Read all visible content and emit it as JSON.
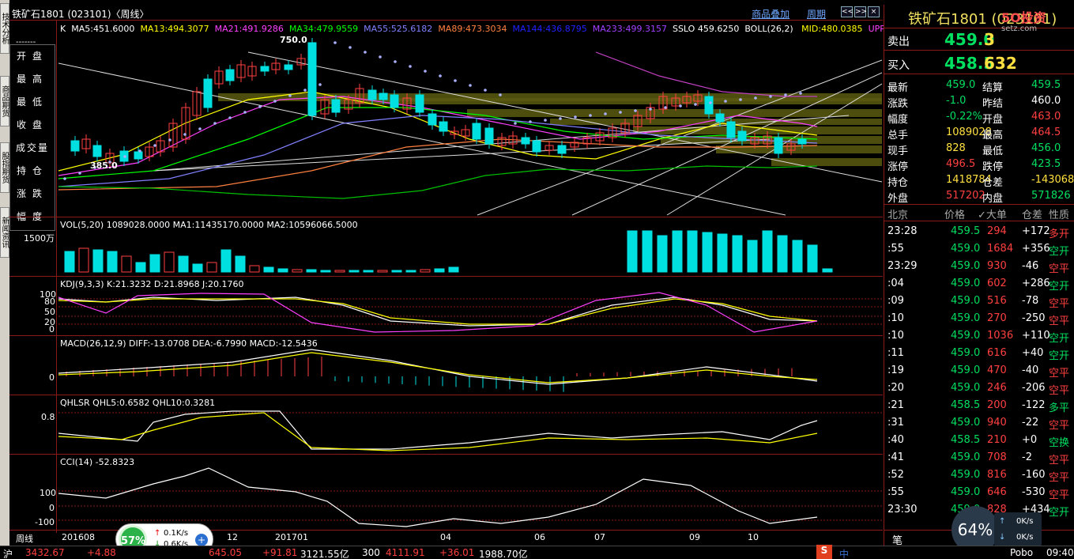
{
  "window": {
    "title": "铁矿石1801 (023101)〈周线〉",
    "links": [
      "商品叠加",
      "周期"
    ],
    "nav_buttons": [
      "<<",
      ">>",
      "×"
    ]
  },
  "side_tabs": [
    "技术分析",
    "商品期货",
    "股指期货",
    "新闻资讯"
  ],
  "left_menu": {
    "dash": "-------",
    "items": [
      "开盘",
      "最高",
      "最低",
      "收盘",
      "成交量",
      "持仓",
      "涨跌",
      "幅度"
    ]
  },
  "main_chart": {
    "header": [
      {
        "text": "K",
        "color": "#ffffff"
      },
      {
        "text": "MA5:451.6000",
        "color": "#ffffff"
      },
      {
        "text": "MA13:494.3077",
        "color": "#ffff00"
      },
      {
        "text": "MA21:491.9286",
        "color": "#ff40ff"
      },
      {
        "text": "MA34:479.9559",
        "color": "#00ff00"
      },
      {
        "text": "MA55:525.6182",
        "color": "#8080ff"
      },
      {
        "text": "MA89:473.3034",
        "color": "#ff8040"
      },
      {
        "text": "MA144:436.8795",
        "color": "#2020ff"
      },
      {
        "text": "MA233:499.3157",
        "color": "#a040ff"
      },
      {
        "text": "SSLO 459.6250",
        "color": "#ffffff"
      },
      {
        "text": "BOLL(26,2) ",
        "color": "#ffffff"
      },
      {
        "text": "MID:480.0385",
        "color": "#ffff00"
      },
      {
        "text": "UPPER",
        "color": "#ff40ff"
      }
    ],
    "high_label": "750.0",
    "low_label": "385.0"
  },
  "vol_panel": {
    "header": "VOL(5,20) 1089028.0000 MA1:11435170.0000 MA2:10596066.5000",
    "scale": "1500万"
  },
  "kdj_panel": {
    "header": "KDJ(9,3,3) K:21.3232 D:21.8968 J:20.1760",
    "levels": [
      "100",
      "80",
      "50",
      "20",
      "0"
    ]
  },
  "macd_panel": {
    "header": "MACD(26,12,9) DIFF:-13.0708 DEA:-6.7990 MACD:-12.5436",
    "zero": "0"
  },
  "qhlsr_panel": {
    "header": "QHLSR QHL5:0.6582 QHL10:0.3281",
    "level": "0.8"
  },
  "cci_panel": {
    "header": "CCI(14) -52.8323",
    "levels": [
      "100",
      "0",
      "-100"
    ]
  },
  "x_axis": {
    "label": "周线",
    "ticks": [
      "201608",
      "12",
      "201701",
      "04",
      "06",
      "07",
      "09",
      "10"
    ]
  },
  "quote": {
    "title": "铁矿石1801 (023101)",
    "brand": "5O投资",
    "brand_sub": "setz.com",
    "ask": {
      "label": "卖出",
      "price": "459.0",
      "vol": "3"
    },
    "bid": {
      "label": "买入",
      "price": "458.5",
      "vol": "632"
    },
    "rows": [
      [
        "最新",
        "459.0",
        "#00e060",
        "结算",
        "459.5",
        "#00e060"
      ],
      [
        "涨跌",
        "-1.0",
        "#00e060",
        "昨结",
        "460.0",
        "#ffffff"
      ],
      [
        "幅度",
        "-0.22%",
        "#00e060",
        "开盘",
        "463.0",
        "#ff4040"
      ],
      [
        "总手",
        "1089028",
        "#ffe040",
        "最高",
        "464.5",
        "#ff4040"
      ],
      [
        "现手",
        "828",
        "#ffe040",
        "最低",
        "456.0",
        "#00e060"
      ],
      [
        "涨停",
        "496.5",
        "#ff4040",
        "跌停",
        "423.5",
        "#00e060"
      ],
      [
        "持仓",
        "1418784",
        "#ffe040",
        "仓差",
        "-143068",
        "#ffe040"
      ],
      [
        "外盘",
        "517202",
        "#ff4040",
        "内盘",
        "571826",
        "#00e060"
      ]
    ],
    "ticks_header": [
      "北京",
      "价格",
      "✓大单",
      "仓差",
      "性质"
    ],
    "ticks": [
      [
        "23:28",
        "459.5",
        "294",
        "+172",
        "多开",
        "#ff4040"
      ],
      [
        ":55",
        "459.0",
        "1684",
        "+356",
        "空开",
        "#00e060"
      ],
      [
        "23:29",
        "459.0",
        "930",
        "-46",
        "空平",
        "#ff4040"
      ],
      [
        ":04",
        "459.0",
        "602",
        "+286",
        "空开",
        "#00e060"
      ],
      [
        ":09",
        "459.0",
        "516",
        "-78",
        "空平",
        "#ff4040"
      ],
      [
        ":10",
        "459.0",
        "270",
        "-250",
        "空平",
        "#ff4040"
      ],
      [
        ":10",
        "459.0",
        "1036",
        "+110",
        "空开",
        "#00e060"
      ],
      [
        ":11",
        "459.0",
        "616",
        "+40",
        "空开",
        "#00e060"
      ],
      [
        ":19",
        "459.0",
        "470",
        "-40",
        "空平",
        "#ff4040"
      ],
      [
        ":20",
        "459.0",
        "246",
        "-206",
        "空平",
        "#ff4040"
      ],
      [
        ":21",
        "458.5",
        "200",
        "-122",
        "多平",
        "#00e060"
      ],
      [
        ":31",
        "459.0",
        "940",
        "-22",
        "空平",
        "#ff4040"
      ],
      [
        ":40",
        "458.5",
        "210",
        "+0",
        "空换",
        "#00e060"
      ],
      [
        ":41",
        "459.0",
        "708",
        "-2",
        "空平",
        "#ff4040"
      ],
      [
        ":52",
        "459.0",
        "816",
        "-160",
        "空平",
        "#ff4040"
      ],
      [
        ":55",
        "459.0",
        "646",
        "-530",
        "空平",
        "#ff4040"
      ],
      [
        "23:30",
        "459.0",
        "828",
        "+434",
        "空开",
        "#00e060"
      ]
    ],
    "footer_label": "笔"
  },
  "status_bar": {
    "items": [
      {
        "text": "沪",
        "color": "#ffffff"
      },
      {
        "text": "3432.67",
        "color": "#ff4040"
      },
      {
        "text": "+4.88",
        "color": "#ff4040"
      },
      {
        "text": "645.05",
        "color": "#ff4040"
      },
      {
        "text": "+91.81",
        "color": "#ff4040"
      },
      {
        "text": "3121.55亿",
        "color": "#ffffff"
      },
      {
        "text": "300",
        "color": "#ffffff"
      },
      {
        "text": "4111.91",
        "color": "#ff4040"
      },
      {
        "text": "+36.01",
        "color": "#ff4040"
      },
      {
        "text": "1988.70亿",
        "color": "#ffffff"
      },
      {
        "text": "Pobo",
        "color": "#ffffff"
      },
      {
        "text": "09:40",
        "color": "#ffffff"
      }
    ],
    "ime": "中"
  },
  "net_widget": {
    "percent": "57%",
    "up": "0.1K/s",
    "down": "0.6K/s"
  },
  "net_widget2": {
    "percent": "64%",
    "up": "0K/s",
    "down": "0K/s"
  }
}
